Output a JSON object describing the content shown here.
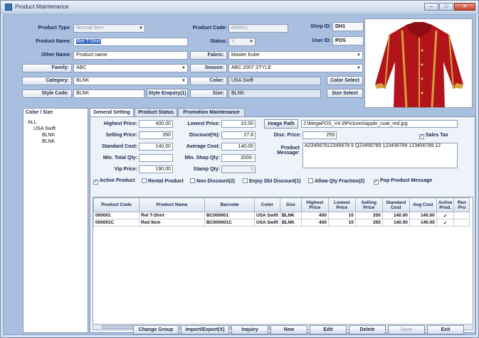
{
  "window": {
    "title": "Product Maintenance",
    "caption_buttons": [
      "–",
      "□",
      "✕"
    ]
  },
  "header": {
    "product_type_label": "Product Type:",
    "product_type_value": "Normal Item",
    "product_code_label": "Product Code:",
    "product_code_value": "000001",
    "shop_id_label": "Shop ID:",
    "shop_id_value": "DH1",
    "product_name_label": "Product Name:",
    "product_name_value": "Ret T-Shirt",
    "status_label": "Status:",
    "status_value": "Y",
    "user_id_label": "User ID:",
    "user_id_value": "POS",
    "other_name_label": "Other Name:",
    "other_name_value": "Product name",
    "fabric_label": "Fabric:",
    "fabric_value": "Master Kobe",
    "family_label": "Family:",
    "family_value": "ABC",
    "season_label": "Season:",
    "season_value": "ABC 2007 STYLE",
    "category_label": "Category:",
    "category_value": "BLNK",
    "color_label": "Color:",
    "color_value": "USA Swift",
    "color_select_label": "Color Select",
    "style_code_label": "Style Code:",
    "style_code_value": "BLNK",
    "style_enquiry_label": "Style Enquiry(1)",
    "size_label": "Size:",
    "size_value": "BLNK",
    "size_select_label": "Size Select"
  },
  "tree": {
    "title": "Color / Size",
    "items": [
      "ALL",
      "USA Swift",
      "BLNK",
      "BLNK"
    ]
  },
  "tabs": [
    "General Setting",
    "Product Status",
    "Promotion Maintenance"
  ],
  "general": {
    "highest_price_label": "Highest Price:",
    "highest_price_value": "400.00",
    "lowest_price_label": "Lowest Price:",
    "lowest_price_value": "10.00",
    "image_path_button": "Image Path",
    "image_path_value": "J:\\MegaPOS_V4.9\\Pictures\\apple_coat_red.jpg",
    "selling_price_label": "Selling Price:",
    "selling_price_value": "350",
    "discount_label": "Discount(%):",
    "discount_value": "27.8",
    "disc_price_label": "Disc. Price:",
    "disc_price_value": "259",
    "sales_tax_label": "Sales Tax",
    "standard_cost_label": "Standard Cost:",
    "standard_cost_value": "140.00",
    "average_cost_label": "Average Cost:",
    "average_cost_value": "140.00",
    "product_message_label": "Product Message:",
    "product_message_value": "A234567812345678 9 Q23456789 123456789 123456789 12",
    "min_total_qty_label": "Min. Total Qty:",
    "min_total_qty_value": "",
    "min_shop_qty_label": "Min. Shop Qty:",
    "min_shop_qty_value": "2000-",
    "vip_price_label": "Vip Price:",
    "vip_price_value": "190.00",
    "stamp_qty_label": "Stamp Qty:",
    "stamp_qty_value": "0"
  },
  "checkboxes": [
    {
      "label": "Active Product",
      "checked": true
    },
    {
      "label": "Rental Product",
      "checked": false
    },
    {
      "label": "Non Discount(2)",
      "checked": false
    },
    {
      "label": "Enjoy Dbl Discount(1)",
      "checked": false
    },
    {
      "label": "Allow Qty Fraction(2)",
      "checked": false
    },
    {
      "label": "Pop Product Message",
      "checked": true
    }
  ],
  "grid": {
    "columns": [
      "Product Code",
      "Product Name",
      "Barcode",
      "Color",
      "Size",
      "Highest Price",
      "Lowest Price",
      "Selling Price",
      "Standard Cost",
      "Avg Cost",
      "Active Prod.",
      "Ren Pro"
    ],
    "rows": [
      [
        "000001",
        "Ret T-Shirt",
        "BC000001",
        "USA Swift",
        "BLNK",
        "400",
        "10",
        "350",
        "140.00",
        "140.00",
        "✓",
        ""
      ],
      [
        "000001C",
        "Red Item",
        "BC000001C",
        "USA Swift",
        "BLNK",
        "400",
        "10",
        "350",
        "140.00",
        "140.00",
        "✓",
        ""
      ]
    ]
  },
  "footer": {
    "buttons": [
      "Change Group",
      "Import/Export(X)",
      "Inquiry",
      "New",
      "Edit",
      "Delete",
      "Save",
      "Exit"
    ]
  }
}
